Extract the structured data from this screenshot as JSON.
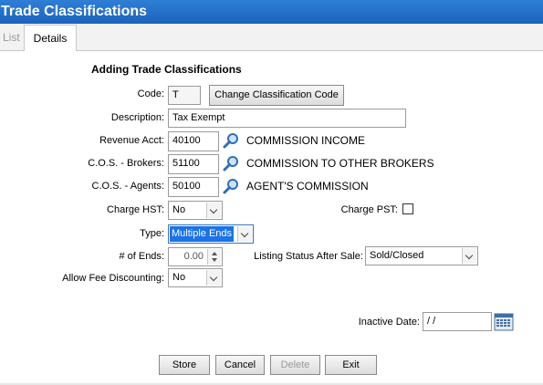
{
  "window": {
    "title": "Trade Classifications"
  },
  "tabs": [
    {
      "label": "List",
      "active": false
    },
    {
      "label": "Details",
      "active": true
    }
  ],
  "form": {
    "heading": "Adding Trade Classifications",
    "code": {
      "label": "Code:",
      "value": "T",
      "change_button": "Change Classification Code"
    },
    "description": {
      "label": "Description:",
      "value": "Tax Exempt"
    },
    "revenue_acct": {
      "label": "Revenue Acct:",
      "value": "40100",
      "name": "COMMISSION INCOME"
    },
    "cos_brokers": {
      "label": "C.O.S. - Brokers:",
      "value": "51100",
      "name": "COMMISSION TO OTHER BROKERS"
    },
    "cos_agents": {
      "label": "C.O.S. - Agents:",
      "value": "50100",
      "name": "AGENT'S COMMISSION"
    },
    "charge_hst": {
      "label": "Charge HST:",
      "value": "No"
    },
    "charge_pst": {
      "label": "Charge PST:",
      "checked": false
    },
    "type": {
      "label": "Type:",
      "value": "Multiple Ends"
    },
    "num_ends": {
      "label": "# of Ends:",
      "value": "0.00"
    },
    "listing_status": {
      "label": "Listing Status After Sale:",
      "value": "Sold/Closed"
    },
    "allow_fee_discounting": {
      "label": "Allow Fee Discounting:",
      "value": "No"
    },
    "inactive_date": {
      "label": "Inactive Date:",
      "value": " / /"
    }
  },
  "buttons": {
    "store": "Store",
    "cancel": "Cancel",
    "delete": "Delete",
    "exit": "Exit"
  },
  "colors": {
    "title_bar": "#1f6fcc",
    "selection": "#1a73e8",
    "search_icon": "#2f6fb5"
  }
}
